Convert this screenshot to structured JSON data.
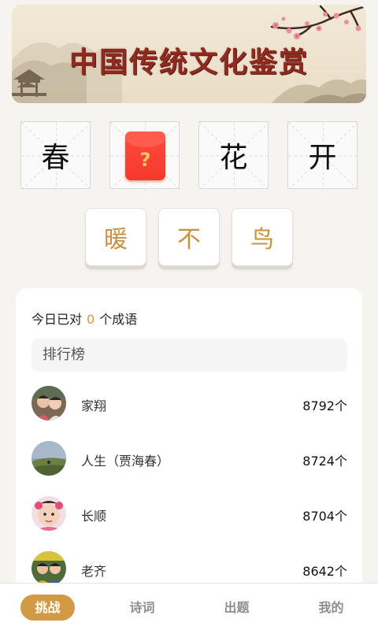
{
  "banner": {
    "title": "中国传统文化鉴赏"
  },
  "puzzle": {
    "cells": [
      {
        "char": "春",
        "hidden": false
      },
      {
        "char": "",
        "hidden": true,
        "placeholder": "?"
      },
      {
        "char": "花",
        "hidden": false
      },
      {
        "char": "开",
        "hidden": false
      }
    ]
  },
  "choices": [
    "暖",
    "不",
    "鸟"
  ],
  "stats": {
    "prefix": "今日已对",
    "count": "0",
    "suffix": "个成语"
  },
  "leaderboard": {
    "title": "排行榜",
    "rows": [
      {
        "name": "家翔",
        "score": "8792个"
      },
      {
        "name": "人生（贾海春）",
        "score": "8724个"
      },
      {
        "name": "长顺",
        "score": "8704个"
      },
      {
        "name": "老齐",
        "score": "8642个"
      }
    ]
  },
  "tabs": [
    {
      "label": "挑战",
      "active": true
    },
    {
      "label": "诗词",
      "active": false
    },
    {
      "label": "出题",
      "active": false
    },
    {
      "label": "我的",
      "active": false
    }
  ],
  "colors": {
    "accent": "#d29a44",
    "choice_text": "#c9913f",
    "red_packet": "#f53a2d",
    "banner_title": "#8f2a20"
  }
}
